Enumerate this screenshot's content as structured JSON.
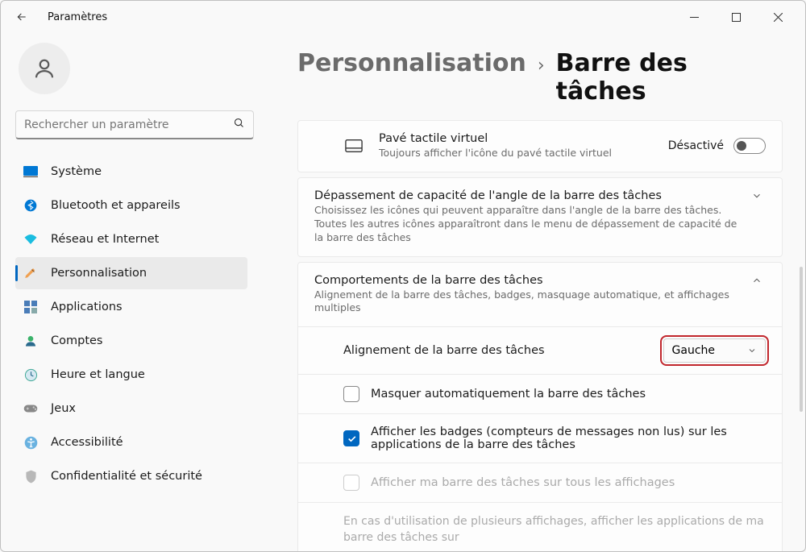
{
  "window": {
    "title": "Paramètres"
  },
  "search": {
    "placeholder": "Rechercher un paramètre"
  },
  "sidebar": {
    "items": [
      {
        "label": "Système"
      },
      {
        "label": "Bluetooth et appareils"
      },
      {
        "label": "Réseau et Internet"
      },
      {
        "label": "Personnalisation"
      },
      {
        "label": "Applications"
      },
      {
        "label": "Comptes"
      },
      {
        "label": "Heure et langue"
      },
      {
        "label": "Jeux"
      },
      {
        "label": "Accessibilité"
      },
      {
        "label": "Confidentialité et sécurité"
      }
    ],
    "activeIndex": 3
  },
  "breadcrumb": {
    "parent": "Personnalisation",
    "sep": "›",
    "current": "Barre des tâches"
  },
  "rows": {
    "virtualTouchpad": {
      "title": "Pavé tactile virtuel",
      "sub": "Toujours afficher l'icône du pavé tactile virtuel",
      "toggleLabel": "Désactivé"
    },
    "overflow": {
      "title": "Dépassement de capacité de l'angle de la barre des tâches",
      "sub": "Choisissez les icônes qui peuvent apparaître dans l'angle de la barre des tâches. Toutes les autres icônes apparaîtront dans le menu de dépassement de capacité de la barre des tâches"
    },
    "behaviors": {
      "title": "Comportements de la barre des tâches",
      "sub": "Alignement de la barre des tâches, badges, masquage automatique, et affichages multiples"
    },
    "alignment": {
      "label": "Alignement de la barre des tâches",
      "value": "Gauche"
    },
    "autoHide": {
      "label": "Masquer automatiquement la barre des tâches"
    },
    "badges": {
      "label": "Afficher les badges (compteurs de messages non lus) sur les applications de la barre des tâches"
    },
    "allDisplays": {
      "label": "Afficher ma barre des tâches sur tous les affichages"
    },
    "multiDisplay": {
      "label": "En cas d'utilisation de plusieurs affichages, afficher les applications de ma barre des tâches sur"
    }
  }
}
